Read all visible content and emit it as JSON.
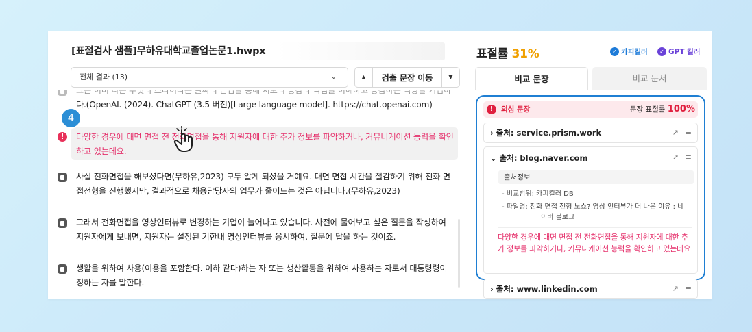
{
  "document": {
    "title": "[표절검사 샘플]무하유대학교졸업논문1.hwpx"
  },
  "filter": {
    "selected": "전체 결과 (13)"
  },
  "navigator": {
    "label": "검출 문장 이동"
  },
  "step_badge": "4",
  "sentences": [
    {
      "text": "그는 이미 다는 무엇의 스타이다는 글싸의 근접을 통해 지보의 공감의 익심을 이해하고 공감하는 역량을 기입하",
      "faded": true
    },
    {
      "text": "다.(OpenAI. (2024). ChatGPT (3.5 버전)[Large language model]. https://chat.openai.com)"
    },
    {
      "text": "다양한 경우에 대면 면접 전 전화면접을 통해 지원자에 대한 추가 정보를 파악하거나, 커뮤니케이션 능력을 확인하고 있는데요.",
      "highlight": true
    },
    {
      "text": "사실 전화면접을 해보셨다면(무하유,2023) 모두 알게 되셨을 거예요. 대면 면접 시간을 절감하기 위해 전화 면접전형을 진행했지만, 결과적으로 채용담당자의 업무가 줄어드는 것은 아닙니다.(무하유,2023)"
    },
    {
      "text": "그래서 전화면접을 영상인터뷰로 변경하는 기업이 늘어나고 있습니다. 사전에 물어보고 싶은 질문을 작성하여 지원자에게 보내면, 지원자는 설정된 기한내 영상인터뷰를 응시하여, 질문에 답을 하는 것이죠."
    },
    {
      "text": "생활을 위하여 사용(이용을 포함한다. 이하 같다)하는 자 또는 생산활동을 위하여 사용하는 자로서 대통령령이 정하는 자를 말한다."
    }
  ],
  "right_panel": {
    "rate_label": "표절률",
    "rate_value": "31%",
    "brands": {
      "copykiller": "카피킬러",
      "gpt": "GPT 킬러"
    },
    "tabs": {
      "compare_sentence": "비교 문장",
      "compare_document": "비교 문서"
    },
    "suspicious": {
      "label": "의심 문장",
      "rate_label": "문장 표절률",
      "rate_value": "100%"
    },
    "sources": [
      {
        "label": "출처: service.prism.work",
        "expanded": false
      },
      {
        "label": "출처: blog.naver.com",
        "expanded": true,
        "info_title": "출처정보",
        "info_lines": [
          "- 비교범위: 카피킬러 DB",
          "- 파일명: 전화 면접 전형 노쇼? 영상 인터뷰가 더 나은 이유 : 네",
          "이버 블로그"
        ],
        "matched_text": "다양한 경우에 대면 면접 전 전화면접을 통해 지원자에 대한 추가 정보를 파악하거나, 커뮤니케이션 능력을 확인하고 있는데요"
      },
      {
        "label": "출처: www.linkedin.com",
        "expanded": false
      }
    ],
    "expand_prefix": "›",
    "collapse_prefix": "⌄"
  },
  "colors": {
    "accent_blue": "#1f7fd3",
    "alert_pink": "#e5306b",
    "rate_orange": "#f0a000"
  }
}
